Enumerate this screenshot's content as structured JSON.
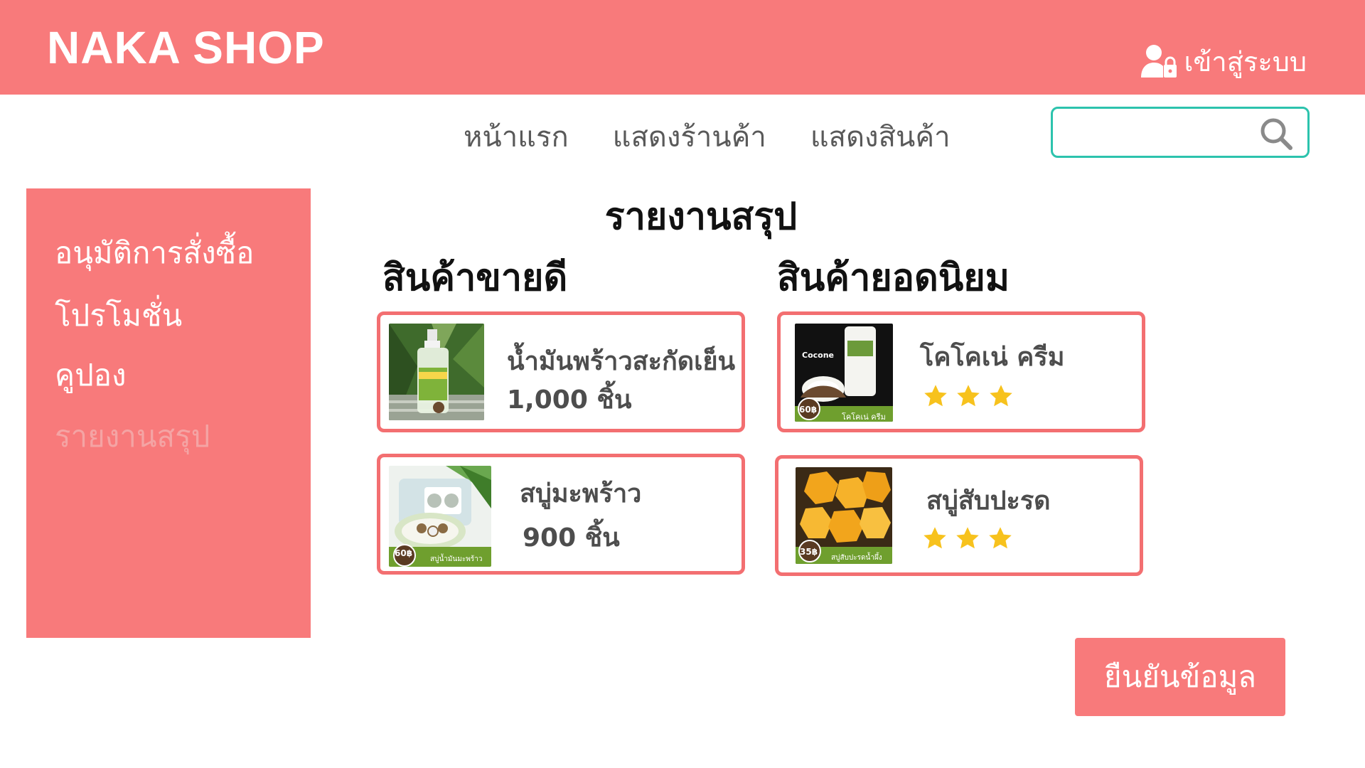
{
  "header": {
    "brand": "NAKA SHOP",
    "login_label": "เข้าสู่ระบบ",
    "background_color": "#f87a7b"
  },
  "nav": {
    "items": [
      "หน้าแรก",
      "แสดงร้านค้า",
      "แสดงสินค้า"
    ]
  },
  "search": {
    "placeholder": "",
    "border_color": "#2cc3ad"
  },
  "sidebar": {
    "items": [
      {
        "label": "อนุมัติการสั่งซื้อ",
        "active": false
      },
      {
        "label": "โปรโมชั่น",
        "active": false
      },
      {
        "label": "คูปอง",
        "active": false
      },
      {
        "label": "รายงานสรุป",
        "active": true
      }
    ]
  },
  "main": {
    "title": "รายงานสรุป",
    "best_selling": {
      "title": "สินค้าขายดี",
      "items": [
        {
          "name": "น้ำมันพร้าวสะกัดเย็น",
          "quantity": "1,000 ชิ้น",
          "image_icon": "coconut-oil-spray-bottle"
        },
        {
          "name": "สบู่มะพร้าว",
          "quantity": "900 ชิ้น",
          "image_icon": "coconut-soap-box",
          "badge": "60฿",
          "caption": "สบู่น้ำมันมะพร้าว"
        }
      ]
    },
    "popular": {
      "title": "สินค้ายอดนิยม",
      "items": [
        {
          "name": "โคโคเน่ ครีม",
          "rating": 3,
          "image_icon": "coconut-cream-tube",
          "badge": "60฿",
          "caption": "โคโคเน่ ครีม",
          "brand_text": "Cocone"
        },
        {
          "name": "สบู่สับปะรด",
          "rating": 3,
          "image_icon": "pineapple-soap-bars",
          "badge": "35฿",
          "caption": "สบู่สับปะรดน้ำผึ้ง"
        }
      ]
    }
  },
  "confirm_button": {
    "label": "ยืนยันข้อมูล"
  },
  "colors": {
    "accent": "#f87a7b",
    "card_border": "#f36f71",
    "star": "#f7c21d",
    "text": "#4d4d4d"
  }
}
